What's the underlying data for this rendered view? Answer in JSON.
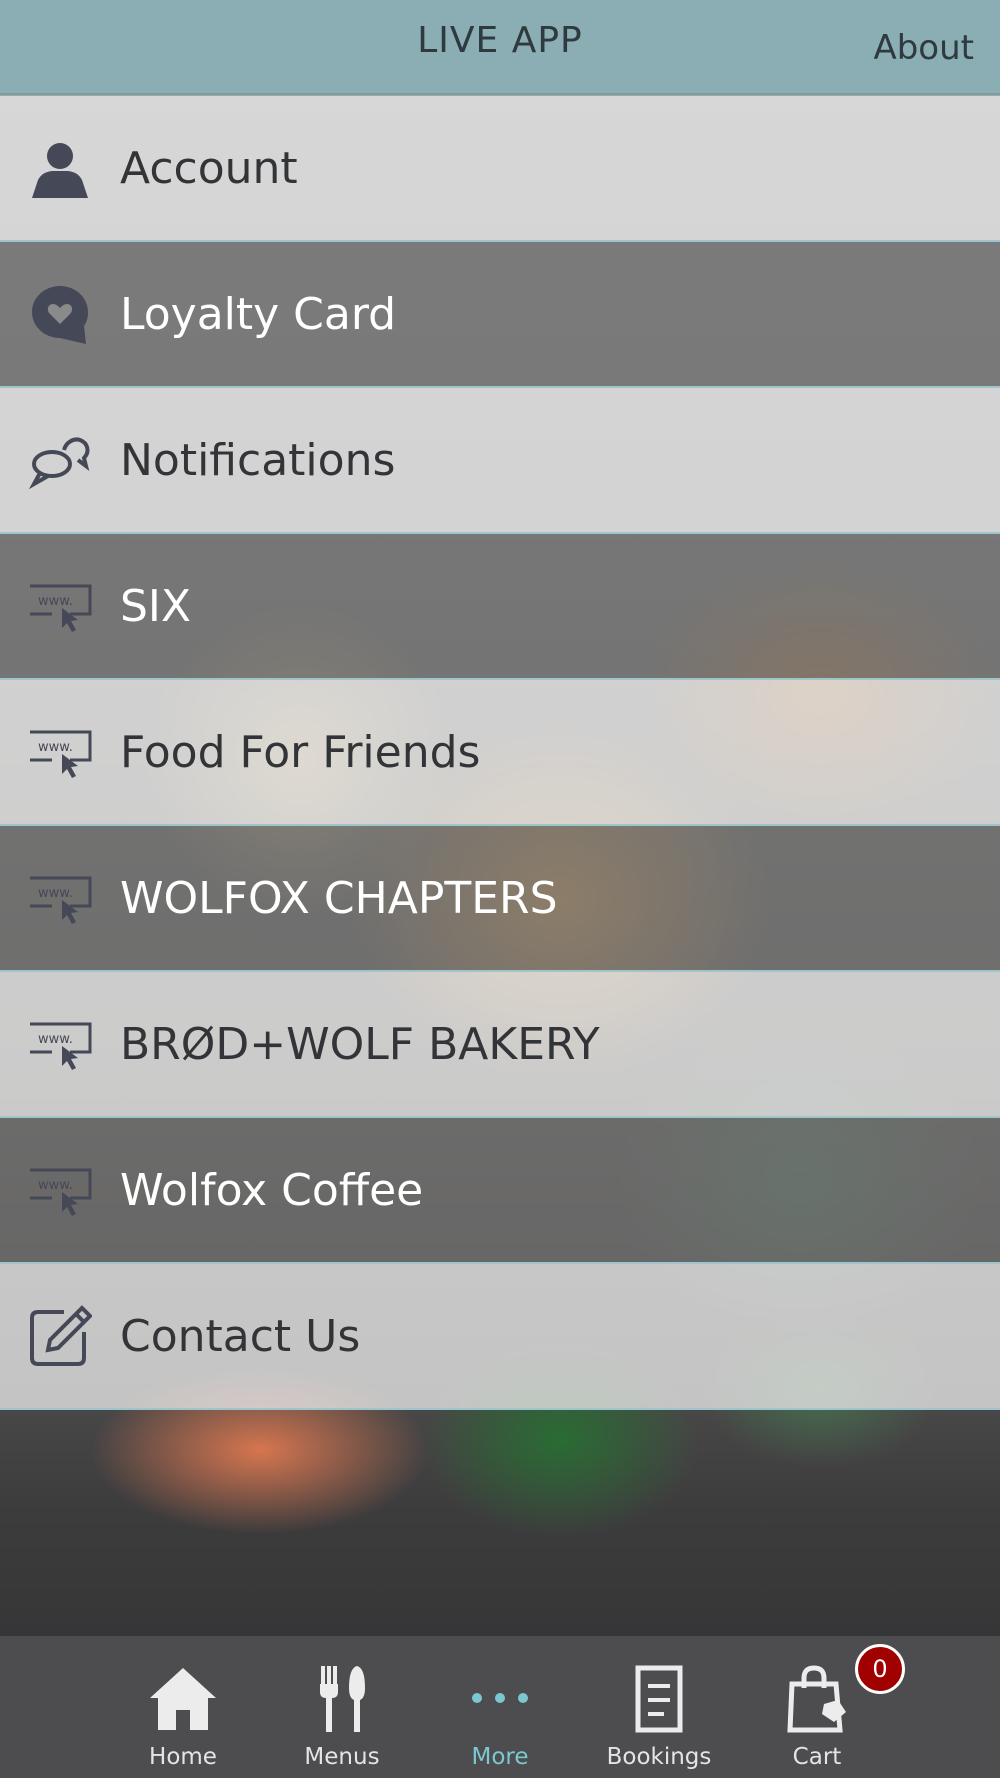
{
  "header": {
    "title": "LIVE APP",
    "about_label": "About"
  },
  "menu": {
    "items": [
      {
        "label": "Account",
        "icon": "person-icon"
      },
      {
        "label": "Loyalty Card",
        "icon": "heart-bubble-icon"
      },
      {
        "label": "Notifications",
        "icon": "chat-bubbles-icon"
      },
      {
        "label": "SIX",
        "icon": "web-link-icon"
      },
      {
        "label": "Food For Friends",
        "icon": "web-link-icon"
      },
      {
        "label": "WOLFOX CHAPTERS",
        "icon": "web-link-icon"
      },
      {
        "label": "BRØD+WOLF BAKERY",
        "icon": "web-link-icon"
      },
      {
        "label": "Wolfox Coffee",
        "icon": "web-link-icon"
      },
      {
        "label": "Contact Us",
        "icon": "edit-icon"
      }
    ]
  },
  "tabbar": {
    "tabs": [
      {
        "label": "Home",
        "icon": "home-icon"
      },
      {
        "label": "Menus",
        "icon": "cutlery-icon"
      },
      {
        "label": "More",
        "icon": "more-dots-icon",
        "active": true
      },
      {
        "label": "Bookings",
        "icon": "document-icon"
      },
      {
        "label": "Cart",
        "icon": "shopping-bag-icon"
      }
    ],
    "cart_count": "0"
  },
  "colors": {
    "header": "#8aaeb3",
    "separator": "#9ec5cc",
    "tabbar": "#4d4d4f",
    "active_tab": "#7cc8d1",
    "badge": "#a00000"
  }
}
